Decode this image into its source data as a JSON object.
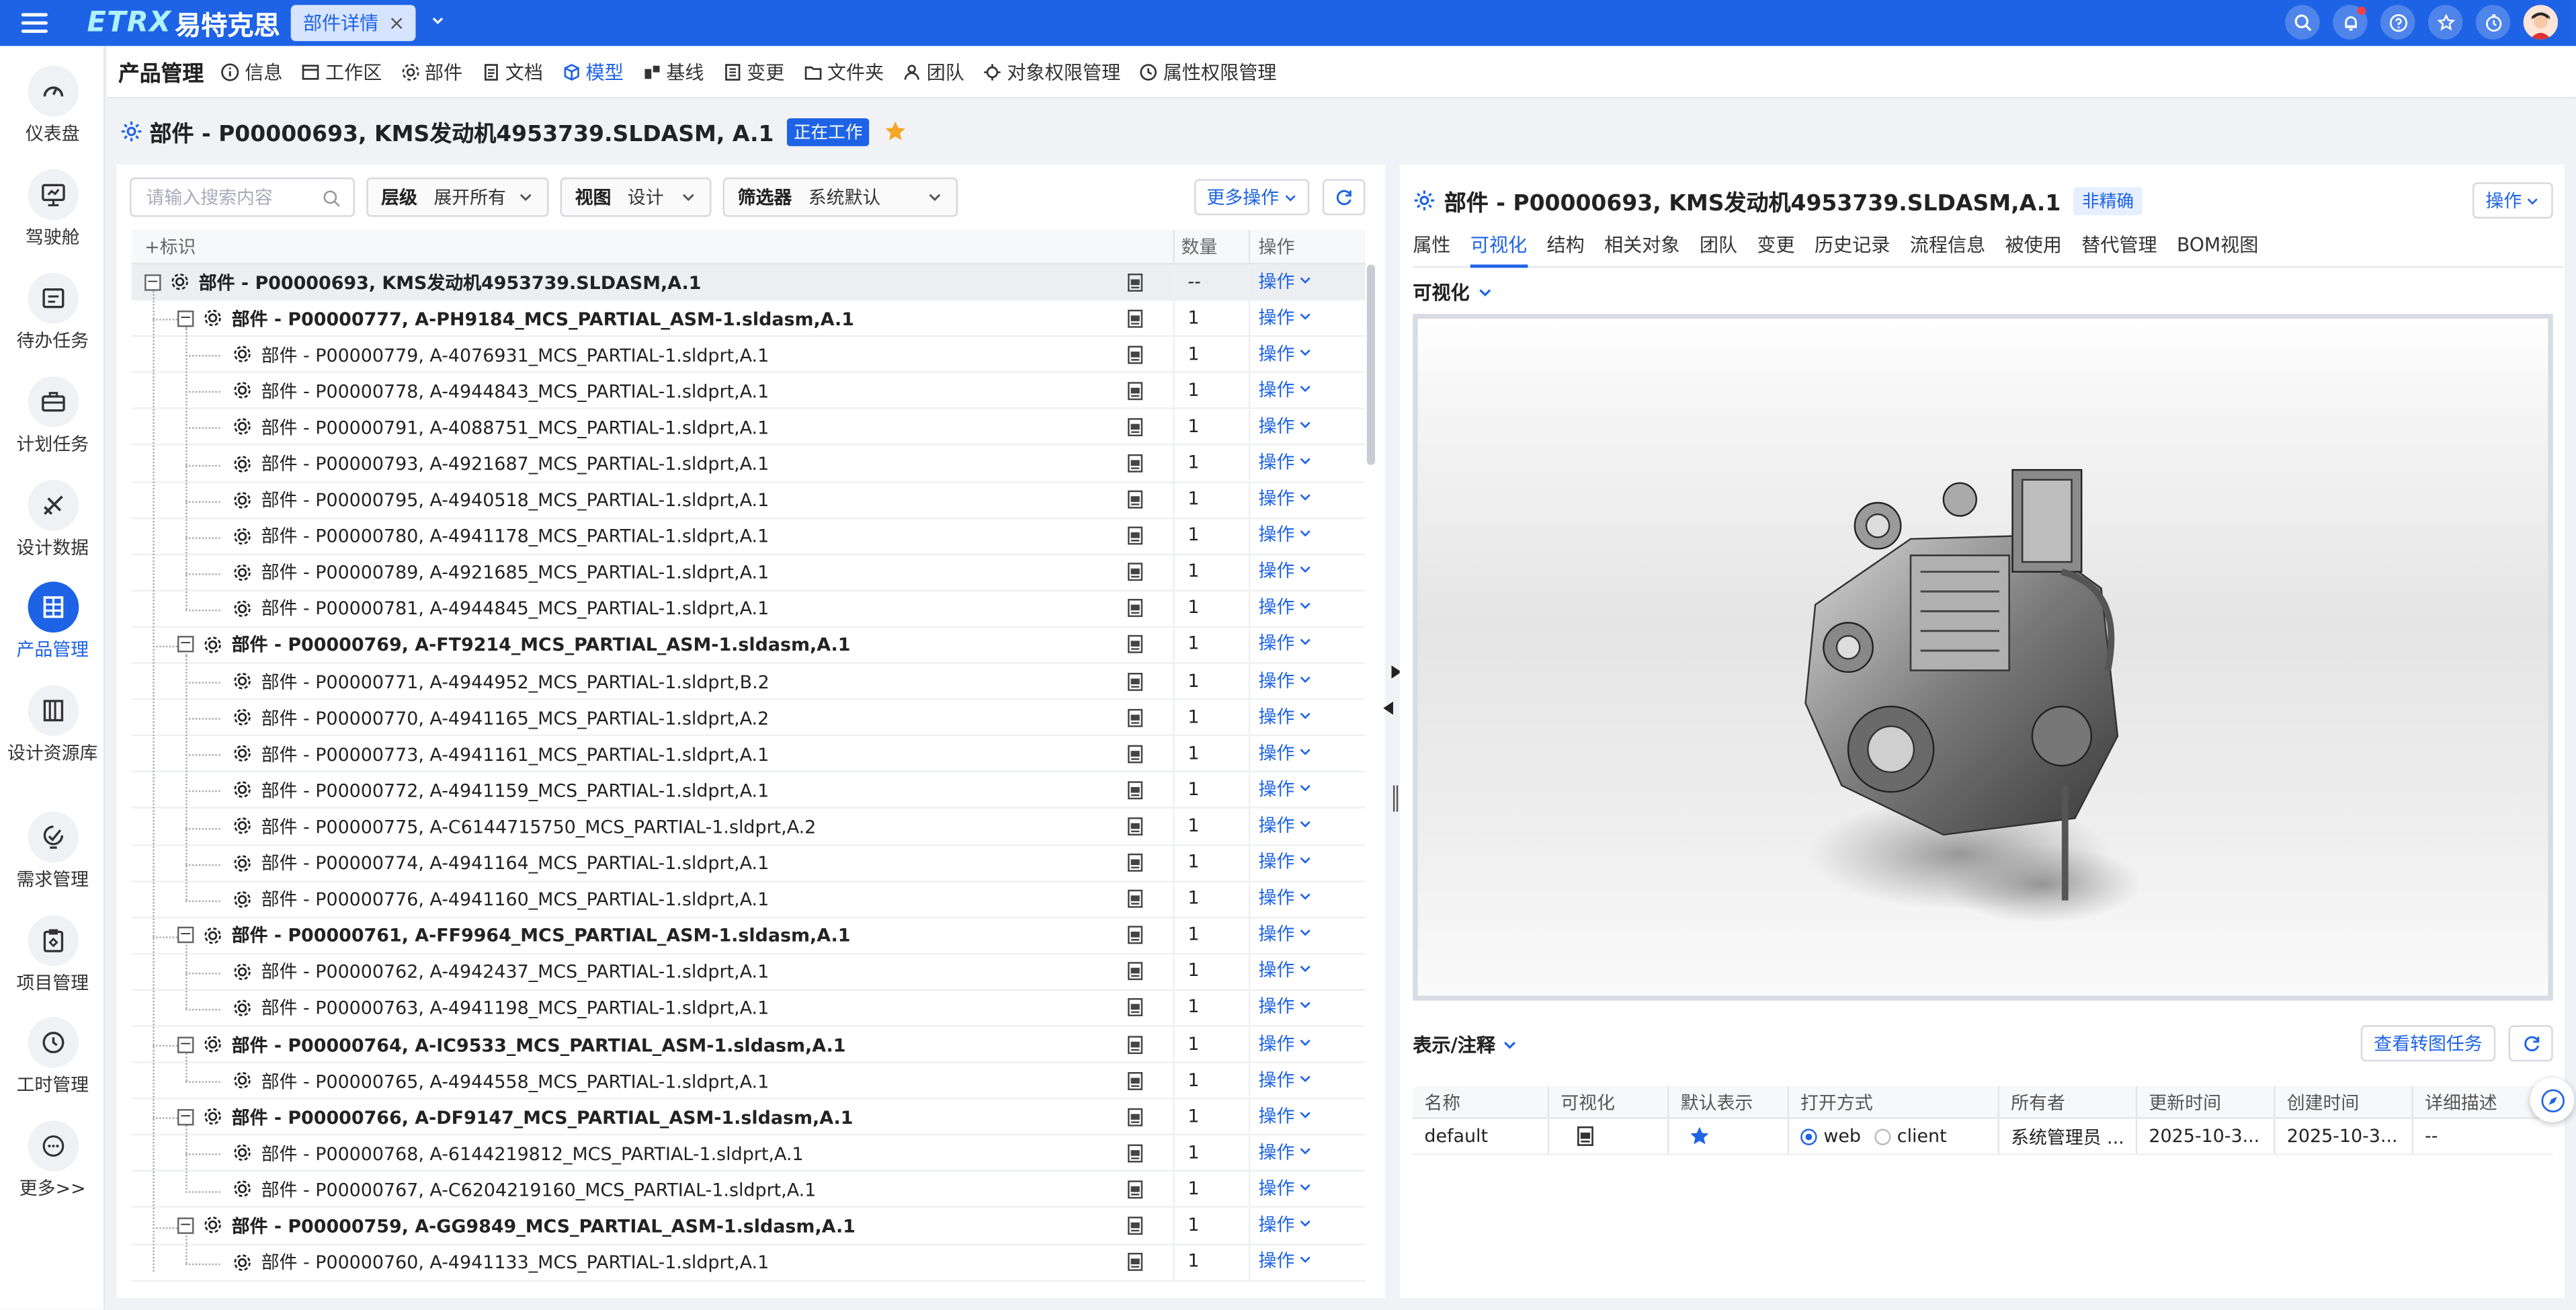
{
  "topbar": {
    "logo_en": "ETRX",
    "logo_cn": "易特克思",
    "tab_label": "部件详情"
  },
  "sidebar": {
    "items": [
      {
        "label": "仪表盘",
        "icon": "dashboard-icon"
      },
      {
        "label": "驾驶舱",
        "icon": "monitor-icon"
      },
      {
        "label": "待办任务",
        "icon": "todo-icon"
      },
      {
        "label": "计划任务",
        "icon": "briefcase-icon"
      },
      {
        "label": "设计数据",
        "icon": "design-data-icon"
      },
      {
        "label": "产品管理",
        "icon": "product-icon"
      },
      {
        "label": "设计资源库",
        "icon": "library-icon"
      },
      {
        "label": "需求管理",
        "icon": "requirement-icon"
      },
      {
        "label": "项目管理",
        "icon": "project-icon"
      },
      {
        "label": "工时管理",
        "icon": "clock-icon"
      },
      {
        "label": "更多>>",
        "icon": "more-icon"
      }
    ]
  },
  "navbar": {
    "title": "产品管理",
    "items": [
      "信息",
      "工作区",
      "部件",
      "文档",
      "模型",
      "基线",
      "变更",
      "文件夹",
      "团队",
      "对象权限管理",
      "属性权限管理"
    ]
  },
  "page": {
    "title": "部件 - P00000693, KMS发动机4953739.SLDASM, A.1",
    "status": "正在工作"
  },
  "left": {
    "search_placeholder": "请输入搜索内容",
    "level_label": "层级",
    "level_value": "展开所有",
    "view_label": "视图",
    "view_value": "设计",
    "filter_label": "筛选器",
    "filter_value": "系统默认",
    "more_ops": "更多操作",
    "col_id": "标识",
    "col_qty": "数量",
    "col_ops": "操作",
    "op_label": "操作",
    "rows": [
      {
        "level": 0,
        "toggle": "−",
        "name": "部件 - P00000693, KMS发动机4953739.SLDASM,A.1",
        "qty": "--"
      },
      {
        "level": 1,
        "toggle": "−",
        "name": "部件 - P00000777, A-PH9184_MCS_PARTIAL_ASM-1.sldasm,A.1",
        "qty": "1"
      },
      {
        "level": 2,
        "toggle": "",
        "name": "部件 - P00000779, A-4076931_MCS_PARTIAL-1.sldprt,A.1",
        "qty": "1"
      },
      {
        "level": 2,
        "toggle": "",
        "name": "部件 - P00000778, A-4944843_MCS_PARTIAL-1.sldprt,A.1",
        "qty": "1"
      },
      {
        "level": 2,
        "toggle": "",
        "name": "部件 - P00000791, A-4088751_MCS_PARTIAL-1.sldprt,A.1",
        "qty": "1"
      },
      {
        "level": 2,
        "toggle": "",
        "name": "部件 - P00000793, A-4921687_MCS_PARTIAL-1.sldprt,A.1",
        "qty": "1"
      },
      {
        "level": 2,
        "toggle": "",
        "name": "部件 - P00000795, A-4940518_MCS_PARTIAL-1.sldprt,A.1",
        "qty": "1"
      },
      {
        "level": 2,
        "toggle": "",
        "name": "部件 - P00000780, A-4941178_MCS_PARTIAL-1.sldprt,A.1",
        "qty": "1"
      },
      {
        "level": 2,
        "toggle": "",
        "name": "部件 - P00000789, A-4921685_MCS_PARTIAL-1.sldprt,A.1",
        "qty": "1"
      },
      {
        "level": 2,
        "toggle": "",
        "name": "部件 - P00000781, A-4944845_MCS_PARTIAL-1.sldprt,A.1",
        "qty": "1"
      },
      {
        "level": 1,
        "toggle": "−",
        "name": "部件 - P00000769, A-FT9214_MCS_PARTIAL_ASM-1.sldasm,A.1",
        "qty": "1"
      },
      {
        "level": 2,
        "toggle": "",
        "name": "部件 - P00000771, A-4944952_MCS_PARTIAL-1.sldprt,B.2",
        "qty": "1"
      },
      {
        "level": 2,
        "toggle": "",
        "name": "部件 - P00000770, A-4941165_MCS_PARTIAL-1.sldprt,A.2",
        "qty": "1"
      },
      {
        "level": 2,
        "toggle": "",
        "name": "部件 - P00000773, A-4941161_MCS_PARTIAL-1.sldprt,A.1",
        "qty": "1"
      },
      {
        "level": 2,
        "toggle": "",
        "name": "部件 - P00000772, A-4941159_MCS_PARTIAL-1.sldprt,A.1",
        "qty": "1"
      },
      {
        "level": 2,
        "toggle": "",
        "name": "部件 - P00000775, A-C6144715750_MCS_PARTIAL-1.sldprt,A.2",
        "qty": "1"
      },
      {
        "level": 2,
        "toggle": "",
        "name": "部件 - P00000774, A-4941164_MCS_PARTIAL-1.sldprt,A.1",
        "qty": "1"
      },
      {
        "level": 2,
        "toggle": "",
        "name": "部件 - P00000776, A-4941160_MCS_PARTIAL-1.sldprt,A.1",
        "qty": "1"
      },
      {
        "level": 1,
        "toggle": "−",
        "name": "部件 - P00000761, A-FF9964_MCS_PARTIAL_ASM-1.sldasm,A.1",
        "qty": "1"
      },
      {
        "level": 2,
        "toggle": "",
        "name": "部件 - P00000762, A-4942437_MCS_PARTIAL-1.sldprt,A.1",
        "qty": "1"
      },
      {
        "level": 2,
        "toggle": "",
        "name": "部件 - P00000763, A-4941198_MCS_PARTIAL-1.sldprt,A.1",
        "qty": "1"
      },
      {
        "level": 1,
        "toggle": "−",
        "name": "部件 - P00000764, A-IC9533_MCS_PARTIAL_ASM-1.sldasm,A.1",
        "qty": "1"
      },
      {
        "level": 2,
        "toggle": "",
        "name": "部件 - P00000765, A-4944558_MCS_PARTIAL-1.sldprt,A.1",
        "qty": "1"
      },
      {
        "level": 1,
        "toggle": "−",
        "name": "部件 - P00000766, A-DF9147_MCS_PARTIAL_ASM-1.sldasm,A.1",
        "qty": "1"
      },
      {
        "level": 2,
        "toggle": "",
        "name": "部件 - P00000768, A-6144219812_MCS_PARTIAL-1.sldprt,A.1",
        "qty": "1"
      },
      {
        "level": 2,
        "toggle": "",
        "name": "部件 - P00000767, A-C6204219160_MCS_PARTIAL-1.sldprt,A.1",
        "qty": "1"
      },
      {
        "level": 1,
        "toggle": "−",
        "name": "部件 - P00000759, A-GG9849_MCS_PARTIAL_ASM-1.sldasm,A.1",
        "qty": "1"
      },
      {
        "level": 2,
        "toggle": "",
        "name": "部件 - P00000760, A-4941133_MCS_PARTIAL-1.sldprt,A.1",
        "qty": "1"
      }
    ]
  },
  "right": {
    "title": "部件 - P00000693, KMS发动机4953739.SLDASM,A.1",
    "tag": "非精确",
    "op_button": "操作",
    "tabs": [
      "属性",
      "可视化",
      "结构",
      "相关对象",
      "团队",
      "变更",
      "历史记录",
      "流程信息",
      "被使用",
      "替代管理",
      "BOM视图"
    ],
    "vis_section": "可视化",
    "rep_section": "表示/注释",
    "view_task_btn": "查看转图任务",
    "rep_columns": [
      "名称",
      "可视化",
      "默认表示",
      "打开方式",
      "所有者",
      "更新时间",
      "创建时间",
      "详细描述"
    ],
    "rep_row": {
      "name": "default",
      "open_web": "web",
      "open_client": "client",
      "owner": "系统管理员 ...",
      "updated": "2025-10-3...",
      "created": "2025-10-3...",
      "desc": "--"
    }
  },
  "colors": {
    "primary": "#1e63e6",
    "star": "#f5a623"
  }
}
